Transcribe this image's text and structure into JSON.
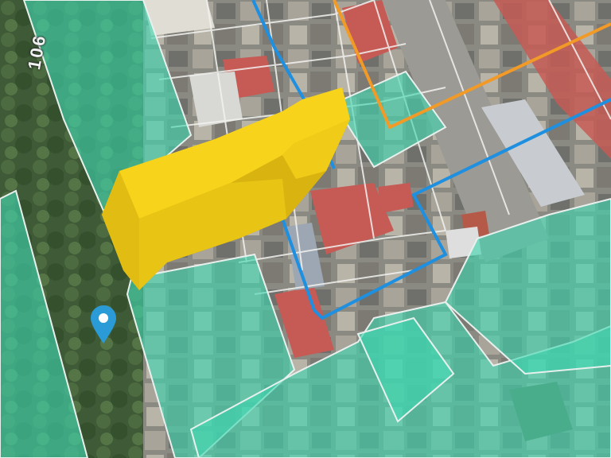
{
  "map": {
    "street_label": "106",
    "layers": {
      "parcel_fill": "teal-parcels",
      "zone_boundaries": [
        "blue-boundary",
        "orange-boundary"
      ],
      "building_3d": "yellow-extruded-building",
      "marker": "location-pin"
    },
    "colors": {
      "parcel": "#3fd6b0",
      "parcel_outline": "#e8f0ee",
      "building_top": "#f7d31c",
      "building_side": "#d9b410",
      "blue_line": "#1f8fe0",
      "orange_line": "#f29a27",
      "pin": "#2a9bd6",
      "roof_red": "#c65a55"
    }
  }
}
